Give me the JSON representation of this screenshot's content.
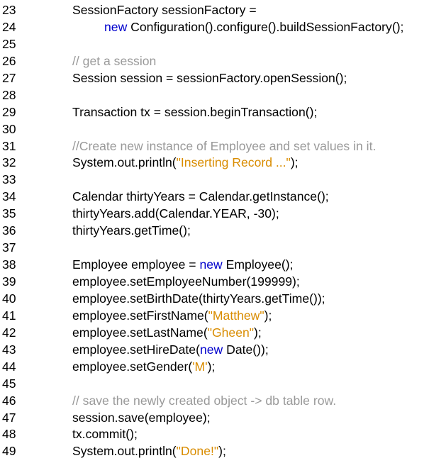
{
  "lines": [
    {
      "n": "23",
      "indent": false,
      "parts": [
        {
          "t": "SessionFactory sessionFactory =",
          "c": "plain"
        }
      ]
    },
    {
      "n": "24",
      "indent": true,
      "parts": [
        {
          "t": "new",
          "c": "kw"
        },
        {
          "t": " Configuration().configure().buildSessionFactory();",
          "c": "plain"
        }
      ]
    },
    {
      "n": "25",
      "indent": false,
      "parts": []
    },
    {
      "n": "26",
      "indent": false,
      "parts": [
        {
          "t": "// get a session",
          "c": "cmt"
        }
      ]
    },
    {
      "n": "27",
      "indent": false,
      "parts": [
        {
          "t": "Session session = sessionFactory.openSession();",
          "c": "plain"
        }
      ]
    },
    {
      "n": "28",
      "indent": false,
      "parts": []
    },
    {
      "n": "29",
      "indent": false,
      "parts": [
        {
          "t": "Transaction tx = session.beginTransaction();",
          "c": "plain"
        }
      ]
    },
    {
      "n": "30",
      "indent": false,
      "parts": []
    },
    {
      "n": "31",
      "indent": false,
      "parts": [
        {
          "t": "//Create new instance of Employee and set values in it.",
          "c": "cmt"
        }
      ]
    },
    {
      "n": "32",
      "indent": false,
      "parts": [
        {
          "t": "System.out.println(",
          "c": "plain"
        },
        {
          "t": "\"Inserting Record ...\"",
          "c": "str"
        },
        {
          "t": ");",
          "c": "plain"
        }
      ]
    },
    {
      "n": "33",
      "indent": false,
      "parts": []
    },
    {
      "n": "34",
      "indent": false,
      "parts": [
        {
          "t": "Calendar thirtyYears = Calendar.getInstance();",
          "c": "plain"
        }
      ]
    },
    {
      "n": "35",
      "indent": false,
      "parts": [
        {
          "t": "thirtyYears.add(Calendar.YEAR, -30);",
          "c": "plain"
        }
      ]
    },
    {
      "n": "36",
      "indent": false,
      "parts": [
        {
          "t": "thirtyYears.getTime();",
          "c": "plain"
        }
      ]
    },
    {
      "n": "37",
      "indent": false,
      "parts": []
    },
    {
      "n": "38",
      "indent": false,
      "parts": [
        {
          "t": "Employee employee = ",
          "c": "plain"
        },
        {
          "t": "new",
          "c": "kw"
        },
        {
          "t": " Employee();",
          "c": "plain"
        }
      ]
    },
    {
      "n": "39",
      "indent": false,
      "parts": [
        {
          "t": "employee.setEmployeeNumber(199999);",
          "c": "plain"
        }
      ]
    },
    {
      "n": "40",
      "indent": false,
      "parts": [
        {
          "t": "employee.setBirthDate(thirtyYears.getTime());",
          "c": "plain"
        }
      ]
    },
    {
      "n": "41",
      "indent": false,
      "parts": [
        {
          "t": "employee.setFirstName(",
          "c": "plain"
        },
        {
          "t": "\"Matthew\"",
          "c": "str"
        },
        {
          "t": ");",
          "c": "plain"
        }
      ]
    },
    {
      "n": "42",
      "indent": false,
      "parts": [
        {
          "t": "employee.setLastName(",
          "c": "plain"
        },
        {
          "t": "\"Gheen\"",
          "c": "str"
        },
        {
          "t": ");",
          "c": "plain"
        }
      ]
    },
    {
      "n": "43",
      "indent": false,
      "parts": [
        {
          "t": "employee.setHireDate(",
          "c": "plain"
        },
        {
          "t": "new",
          "c": "kw"
        },
        {
          "t": " Date());",
          "c": "plain"
        }
      ]
    },
    {
      "n": "44",
      "indent": false,
      "parts": [
        {
          "t": "employee.setGender(",
          "c": "plain"
        },
        {
          "t": "'M'",
          "c": "str"
        },
        {
          "t": ");",
          "c": "plain"
        }
      ]
    },
    {
      "n": "45",
      "indent": false,
      "parts": []
    },
    {
      "n": "46",
      "indent": false,
      "parts": [
        {
          "t": "// save the newly created object -> db table row.",
          "c": "cmt"
        }
      ]
    },
    {
      "n": "47",
      "indent": false,
      "parts": [
        {
          "t": "session.save(employee);",
          "c": "plain"
        }
      ]
    },
    {
      "n": "48",
      "indent": false,
      "parts": [
        {
          "t": "tx.commit();",
          "c": "plain"
        }
      ]
    },
    {
      "n": "49",
      "indent": false,
      "parts": [
        {
          "t": "System.out.println(",
          "c": "plain"
        },
        {
          "t": "\"Done!\"",
          "c": "str"
        },
        {
          "t": ");",
          "c": "plain"
        }
      ]
    }
  ],
  "colors": {
    "keyword": "#0000cc",
    "string": "#d98c00",
    "comment": "#999999",
    "text": "#000000"
  }
}
